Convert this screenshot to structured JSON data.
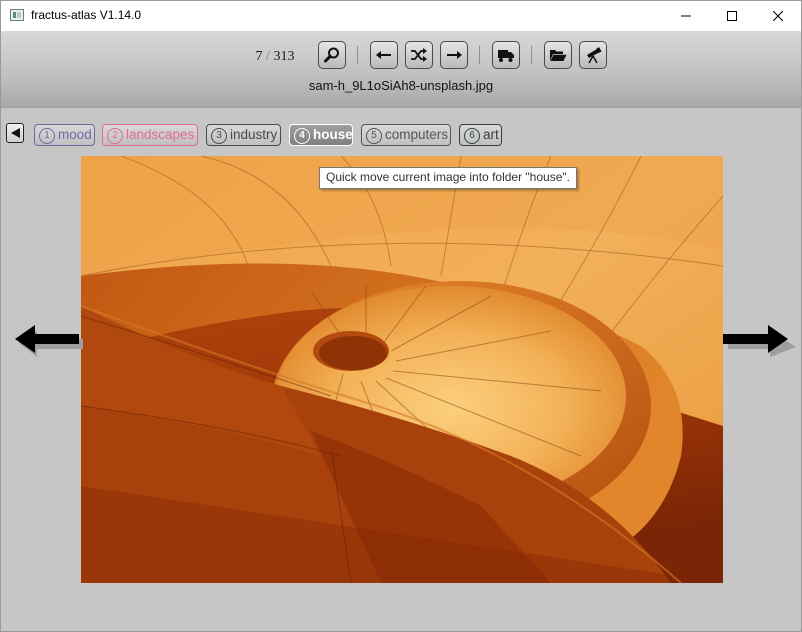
{
  "window": {
    "title": "fractus-atlas V1.14.0",
    "app_icon": "app-logo-icon",
    "controls": [
      "minimize-icon",
      "maximize-icon",
      "close-icon"
    ]
  },
  "toolbar": {
    "counter": {
      "current": "7",
      "separator": "/",
      "total": "313"
    },
    "buttons": [
      {
        "name": "search",
        "icon": "magnifier-icon"
      },
      {
        "name": "previous",
        "icon": "arrow-left-icon"
      },
      {
        "name": "shuffle",
        "icon": "shuffle-icon"
      },
      {
        "name": "next",
        "icon": "arrow-right-icon"
      },
      {
        "name": "move",
        "icon": "truck-icon"
      },
      {
        "name": "open-folder",
        "icon": "folder-open-icon"
      },
      {
        "name": "explore",
        "icon": "telescope-icon"
      }
    ],
    "filename": "sam-h_9L1oSiAh8-unsplash.jpg"
  },
  "folders": {
    "back_icon": "triangle-left-icon",
    "items": [
      {
        "num": "1",
        "label": "mood",
        "color": "#6b6aa6"
      },
      {
        "num": "2",
        "label": "landscapes",
        "color": "#e06a9a"
      },
      {
        "num": "3",
        "label": "industry",
        "color": "#4a4a4a"
      },
      {
        "num": "4",
        "label": "house",
        "color": "#ffffff",
        "active": true
      },
      {
        "num": "5",
        "label": "computers",
        "color": "#555555"
      },
      {
        "num": "6",
        "label": "art",
        "color": "#33413c"
      }
    ]
  },
  "tooltip": {
    "text": "Quick move current image into folder \"house\"."
  },
  "viewer": {
    "image_subject": "orange spiral architecture photo",
    "left_nav_icon": "arrow-left-icon",
    "right_nav_icon": "arrow-right-icon"
  }
}
